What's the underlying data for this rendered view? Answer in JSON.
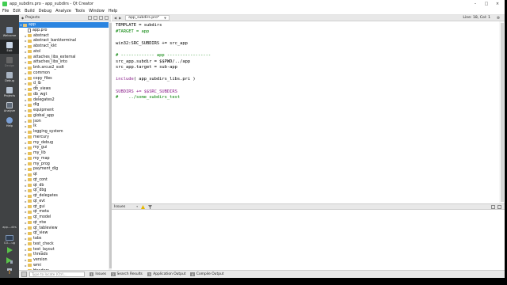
{
  "window": {
    "title": "app_subdirs.pro - app_subdirs - Qt Creator",
    "controls": [
      "–",
      "□",
      "×"
    ]
  },
  "menu": [
    "File",
    "Edit",
    "Build",
    "Debug",
    "Analyze",
    "Tools",
    "Window",
    "Help"
  ],
  "modes": [
    {
      "label": "Welcome",
      "icon": "welcome-icon"
    },
    {
      "label": "Edit",
      "icon": "edit-icon"
    },
    {
      "label": "Design",
      "icon": "design-icon"
    },
    {
      "label": "Debug",
      "icon": "debug-icon"
    },
    {
      "label": "Projects",
      "icon": "projects-icon"
    },
    {
      "label": "Analyze",
      "icon": "analyze-icon"
    },
    {
      "label": "Help",
      "icon": "help-icon"
    }
  ],
  "kit": {
    "project": "app....dirs",
    "config": "CO....ug"
  },
  "projects_pane": {
    "title": "Projects",
    "root": "app",
    "items": [
      {
        "label": "app.pro",
        "type": "pro"
      },
      {
        "label": "abstract",
        "type": "folder"
      },
      {
        "label": "abstract_bankterminal",
        "type": "folder"
      },
      {
        "label": "abstract_kkt",
        "type": "folder"
      },
      {
        "label": "atol",
        "type": "folder"
      },
      {
        "label": "attaches_libs_external",
        "type": "folder"
      },
      {
        "label": "attaches_libs_into",
        "type": "folder"
      },
      {
        "label": "bnk.arcus2_ssdt",
        "type": "folder"
      },
      {
        "label": "common",
        "type": "folder"
      },
      {
        "label": "copy_files",
        "type": "folder"
      },
      {
        "label": "d_lb",
        "type": "folder"
      },
      {
        "label": "db_views",
        "type": "folder"
      },
      {
        "label": "db_wgt",
        "type": "folder"
      },
      {
        "label": "delegates2",
        "type": "folder"
      },
      {
        "label": "dlg",
        "type": "folder"
      },
      {
        "label": "equipment",
        "type": "folder"
      },
      {
        "label": "global_app",
        "type": "folder"
      },
      {
        "label": "json",
        "type": "folder"
      },
      {
        "label": "lk",
        "type": "folder"
      },
      {
        "label": "logging_system",
        "type": "folder"
      },
      {
        "label": "mercury",
        "type": "folder"
      },
      {
        "label": "my_debug",
        "type": "folder"
      },
      {
        "label": "my_gui",
        "type": "folder"
      },
      {
        "label": "my_lib",
        "type": "folder"
      },
      {
        "label": "my_map",
        "type": "folder"
      },
      {
        "label": "my_prog",
        "type": "folder"
      },
      {
        "label": "payment_dlg",
        "type": "folder"
      },
      {
        "label": "qt",
        "type": "folder"
      },
      {
        "label": "qt_cont",
        "type": "folder"
      },
      {
        "label": "qt_db",
        "type": "folder"
      },
      {
        "label": "qt_dbg",
        "type": "folder"
      },
      {
        "label": "qt_delegates",
        "type": "folder"
      },
      {
        "label": "qt_evt",
        "type": "folder"
      },
      {
        "label": "qt_gui",
        "type": "folder"
      },
      {
        "label": "qt_meta",
        "type": "folder"
      },
      {
        "label": "qt_model",
        "type": "folder"
      },
      {
        "label": "qt_ntw",
        "type": "folder"
      },
      {
        "label": "qt_tableview",
        "type": "folder"
      },
      {
        "label": "qt_view",
        "type": "folder"
      },
      {
        "label": "tabs",
        "type": "folder"
      },
      {
        "label": "test_check",
        "type": "folder"
      },
      {
        "label": "test_layout",
        "type": "folder"
      },
      {
        "label": "threads",
        "type": "folder"
      },
      {
        "label": "version",
        "type": "folder"
      },
      {
        "label": "wmi",
        "type": "folder"
      },
      {
        "label": "Headers",
        "type": "folder"
      }
    ]
  },
  "editor": {
    "file_name": "app_subdirs.pro*",
    "position": "Line: 18, Col: 1",
    "lines": [
      [
        {
          "t": "TEMPLATE = subdirs",
          "c": "c-plain"
        }
      ],
      [
        {
          "t": "#TARGET = app",
          "c": "c-comment"
        }
      ],
      [
        {
          "t": "",
          "c": "c-plain"
        }
      ],
      [
        {
          "t": "win32:SRC_SUBDIRS += src_app",
          "c": "c-plain"
        }
      ],
      [
        {
          "t": "",
          "c": "c-plain"
        }
      ],
      [
        {
          "t": "# ------------- app -----------------",
          "c": "c-comment"
        }
      ],
      [
        {
          "t": "src_app.subdir = $$PWD/../app",
          "c": "c-plain"
        }
      ],
      [
        {
          "t": "src_app.target = sub-app",
          "c": "c-plain"
        }
      ],
      [
        {
          "t": "",
          "c": "c-plain"
        }
      ],
      [
        {
          "t": "include",
          "c": "c-keyword"
        },
        {
          "t": "( app_subdirs_libs.pri )",
          "c": "c-plain"
        }
      ],
      [
        {
          "t": "",
          "c": "c-plain"
        }
      ],
      [
        {
          "t": "SUBDIRS += $$SRC_SUBDIRS",
          "c": "c-keyword"
        }
      ],
      [
        {
          "t": "#    ../some_subdirs_test",
          "c": "c-comment"
        }
      ]
    ]
  },
  "issues": {
    "title": "Issues",
    "filter_dropdown": "▾"
  },
  "statusbar": {
    "locate_placeholder": "Type to locate (Ctrl...",
    "tabs": [
      {
        "num": "1",
        "label": "Issues"
      },
      {
        "num": "2",
        "label": "Search Results"
      },
      {
        "num": "3",
        "label": "Application Output"
      },
      {
        "num": "4",
        "label": "Compile Output"
      }
    ]
  }
}
